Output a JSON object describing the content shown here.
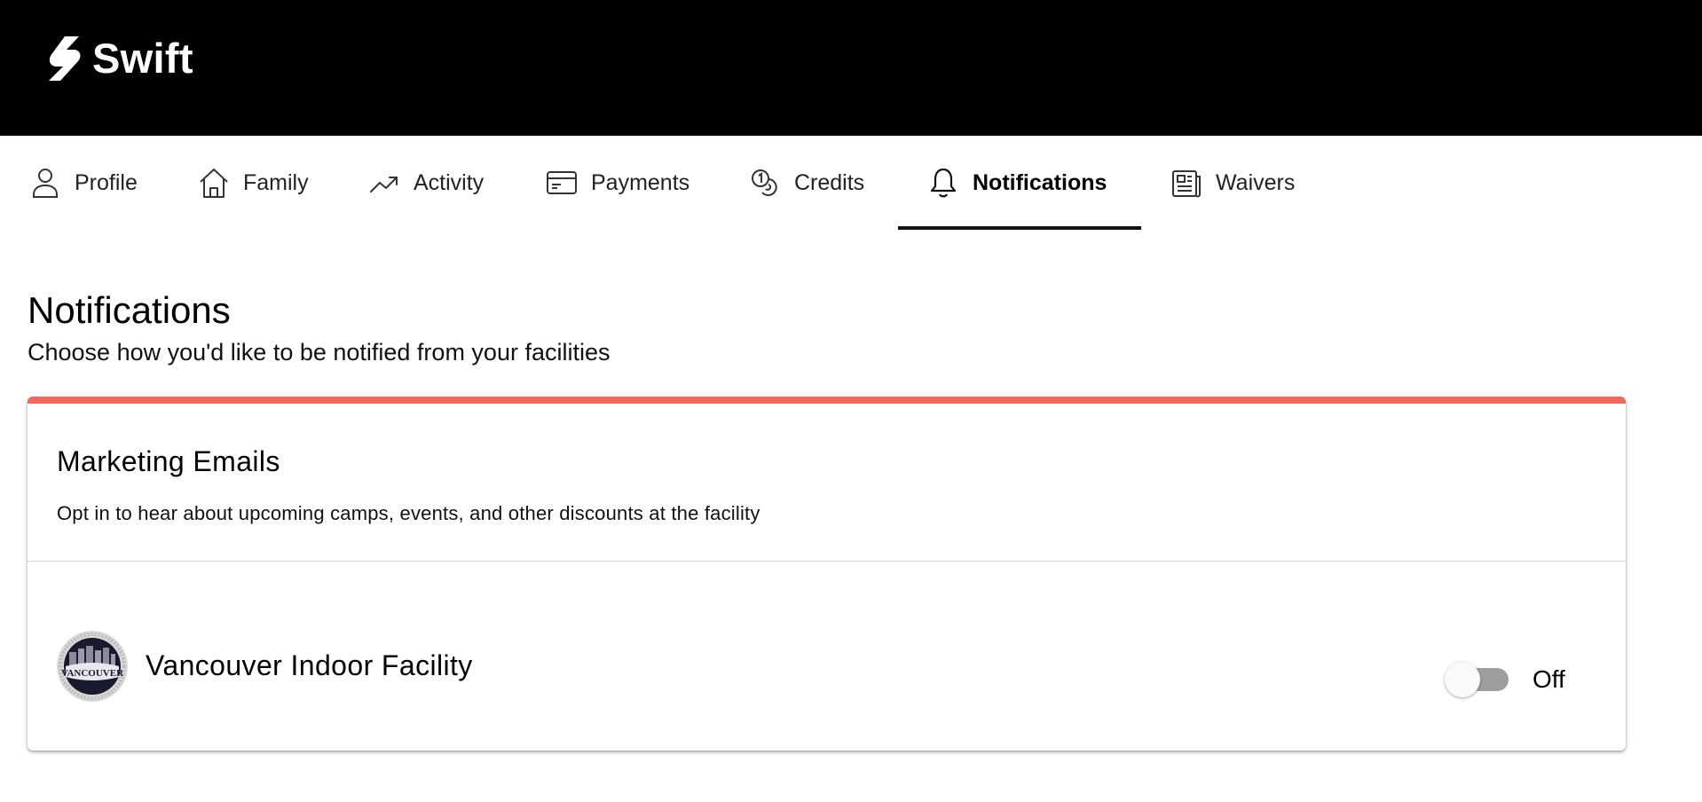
{
  "app": {
    "name": "Swift"
  },
  "tabs": [
    {
      "label": "Profile",
      "icon": "person-icon",
      "active": false
    },
    {
      "label": "Family",
      "icon": "home-icon",
      "active": false
    },
    {
      "label": "Activity",
      "icon": "trending-up-icon",
      "active": false
    },
    {
      "label": "Payments",
      "icon": "credit-card-icon",
      "active": false
    },
    {
      "label": "Credits",
      "icon": "coins-icon",
      "active": false
    },
    {
      "label": "Notifications",
      "icon": "bell-icon",
      "active": true
    },
    {
      "label": "Waivers",
      "icon": "document-icon",
      "active": false
    }
  ],
  "page": {
    "title": "Notifications",
    "subtitle": "Choose how you'd like to be notified from your facilities"
  },
  "card": {
    "accent_color": "#ec6a5e",
    "title": "Marketing Emails",
    "description": "Opt in to hear about upcoming camps, events, and other discounts at the facility",
    "facility": {
      "name": "Vancouver Indoor Facility",
      "logo_text": "VANCOUVER",
      "logo_icon": "facility-badge-logo",
      "toggle_on": false,
      "toggle_label": "Off"
    }
  }
}
